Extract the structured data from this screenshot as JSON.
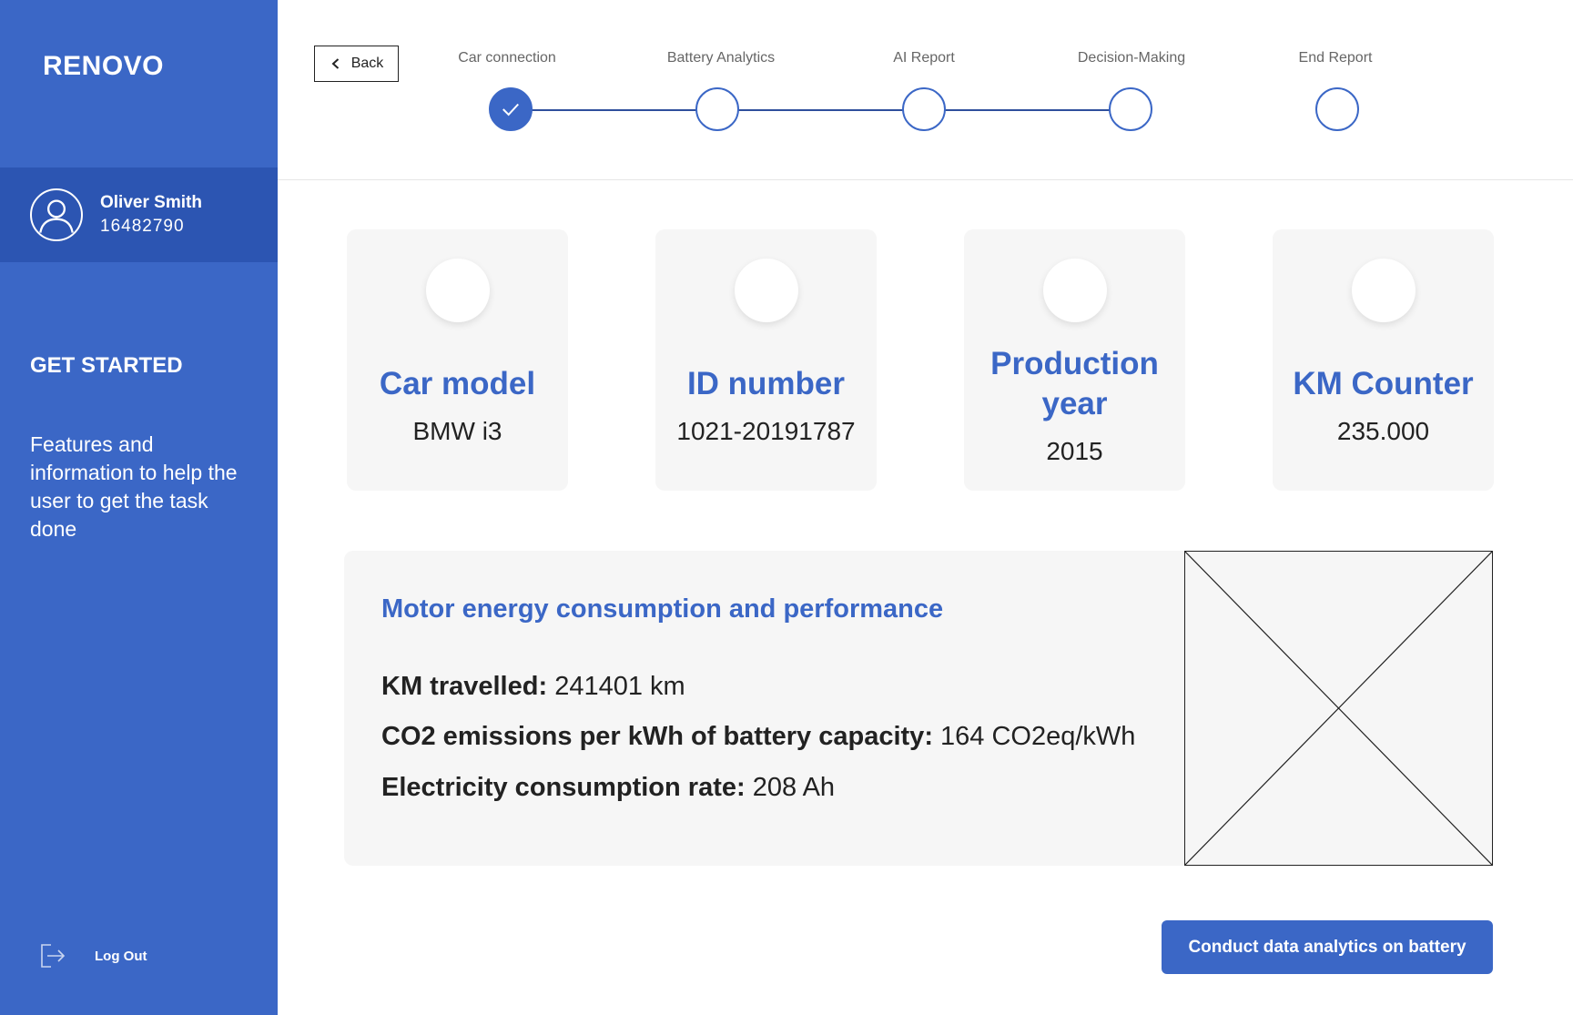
{
  "app": {
    "logo": "RENOVO"
  },
  "user": {
    "name": "Oliver Smith",
    "id": "16482790"
  },
  "sidebar": {
    "section_title": "GET STARTED",
    "help_text": "Features and information to help the user to get the task done",
    "logout_label": "Log Out"
  },
  "header": {
    "back_label": "Back",
    "steps": [
      {
        "label": "Car connection",
        "state": "completed"
      },
      {
        "label": "Battery Analytics",
        "state": "pending"
      },
      {
        "label": "AI Report",
        "state": "pending"
      },
      {
        "label": "Decision-Making",
        "state": "pending"
      },
      {
        "label": "End Report",
        "state": "pending"
      }
    ]
  },
  "cards": [
    {
      "title": "Car model",
      "value": "BMW i3"
    },
    {
      "title": "ID number",
      "value": "1021-20191787"
    },
    {
      "title": "Production year",
      "value": "2015"
    },
    {
      "title": "KM Counter",
      "value": "235.000"
    }
  ],
  "motor_panel": {
    "title": "Motor energy consumption and performance",
    "metrics": [
      {
        "label": "KM travelled",
        "value": "241401 km"
      },
      {
        "label": "CO2 emissions per kWh of battery capacity",
        "value": "164 CO2eq/kWh"
      },
      {
        "label": "Electricity consumption rate",
        "value": "208 Ah"
      }
    ]
  },
  "cta": {
    "label": "Conduct data analytics on battery"
  },
  "colors": {
    "primary": "#3b67c6",
    "primary_dark": "#2c55b2",
    "card_bg": "#f6f6f6",
    "text": "#222222"
  },
  "icons": {
    "back": "chevron-left-icon",
    "avatar": "user-icon",
    "logout": "logout-icon",
    "step_done": "check-icon",
    "image_placeholder": "image-placeholder"
  }
}
